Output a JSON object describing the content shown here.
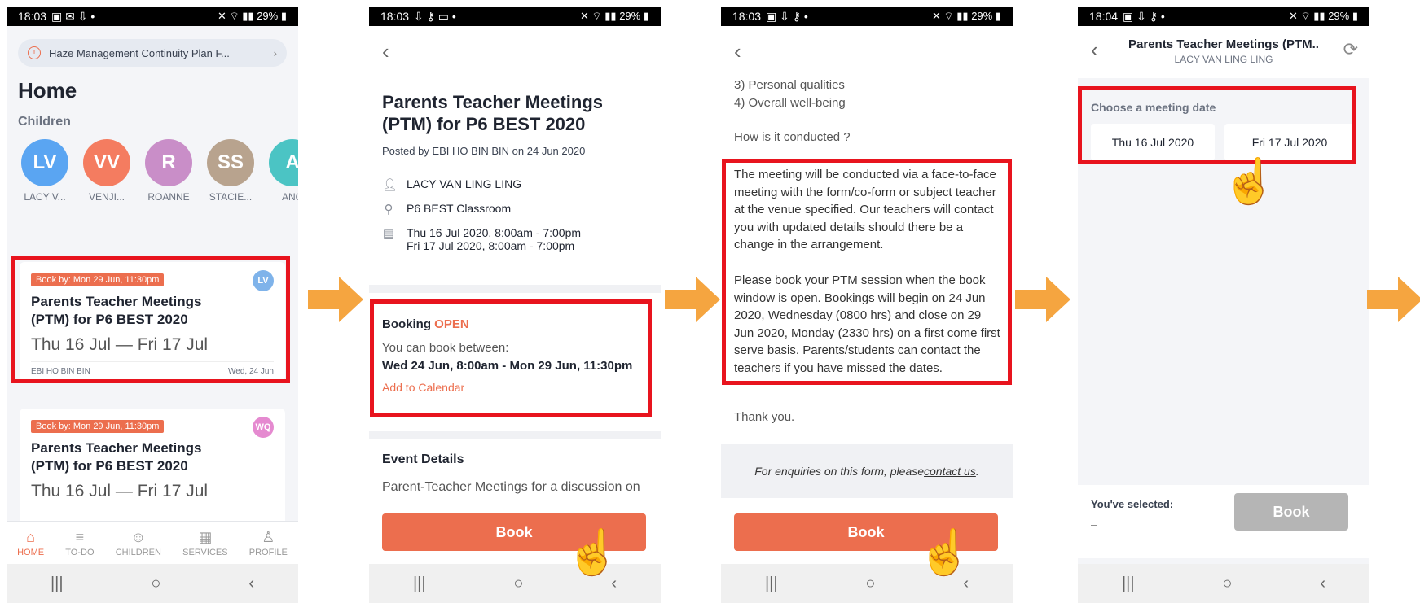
{
  "phone1": {
    "status": {
      "time": "18:03",
      "right": "29%"
    },
    "banner": "Haze Management Continuity Plan F...",
    "title": "Home",
    "children_label": "Children",
    "children": [
      {
        "initials": "LV",
        "name": "LACY V...",
        "color": "#5aa5f2"
      },
      {
        "initials": "VV",
        "name": "VENJI...",
        "color": "#f47c60"
      },
      {
        "initials": "R",
        "name": "ROANNE",
        "color": "#c98ec8"
      },
      {
        "initials": "SS",
        "name": "STACIE...",
        "color": "#b8a38e"
      },
      {
        "initials": "A",
        "name": "ANG",
        "color": "#4bc4c4"
      }
    ],
    "cards": [
      {
        "tag": "Book by: Mon 29 Jun, 11:30pm",
        "avatar": "LV",
        "avatar_color": "#7fb3ea",
        "title": "Parents Teacher Meetings (PTM) for P6 BEST 2020",
        "dates": "Thu 16 Jul — Fri 17 Jul",
        "author": "EBI HO BIN BIN",
        "posted": "Wed, 24 Jun"
      },
      {
        "tag": "Book by: Mon 29 Jun, 11:30pm",
        "avatar": "WQ",
        "avatar_color": "#e58ad0",
        "title": "Parents Teacher Meetings (PTM) for P6 BEST 2020",
        "dates": "Thu 16 Jul — Fri 17 Jul"
      }
    ],
    "tabs": [
      {
        "icon": "⌂",
        "label": "HOME"
      },
      {
        "icon": "≡",
        "label": "TO-DO"
      },
      {
        "icon": "☺",
        "label": "CHILDREN"
      },
      {
        "icon": "▦",
        "label": "SERVICES"
      },
      {
        "icon": "♙",
        "label": "PROFILE"
      }
    ]
  },
  "phone2": {
    "status": {
      "time": "18:03",
      "right": "29%"
    },
    "title": "Parents Teacher Meetings (PTM) for P6 BEST 2020",
    "posted_by": "Posted by EBI HO BIN BIN on 24 Jun 2020",
    "student": "LACY VAN LING LING",
    "venue": "P6 BEST Classroom",
    "date1": "Thu 16 Jul 2020, 8:00am - 7:00pm",
    "date2": "Fri 17 Jul 2020, 8:00am - 7:00pm",
    "booking_label": "Booking",
    "booking_status": "OPEN",
    "book_between": "You can book between:",
    "window": "Wed 24 Jun, 8:00am - Mon 29 Jun, 11:30pm",
    "add_calendar": "Add to Calendar",
    "event_details": "Event Details",
    "event_text": "Parent-Teacher Meetings for a discussion on",
    "book": "Book"
  },
  "phone3": {
    "status": {
      "time": "18:03",
      "right": "29%"
    },
    "line1": "3) Personal qualities",
    "line2": "4) Overall well-being",
    "how": "How is it  conducted ?",
    "para1": "The meeting will be conducted via a face-to-face meeting with the form/co-form or subject teacher at the venue specified. Our teachers will contact you with updated details should there be a change in the arrangement.",
    "para2": "Please book your PTM session when the book window is open. Bookings will begin on 24 Jun 2020, Wednesday (0800 hrs) and close on 29 Jun 2020, Monday (2330 hrs) on a first come first serve basis. Parents/students can contact the  teachers if you have missed the dates.",
    "thanks": "Thank you.",
    "enquiry_pre": "For enquiries on this form, please ",
    "enquiry_link": "contact us",
    "enquiry_post": ".",
    "book": "Book"
  },
  "phone4": {
    "status": {
      "time": "18:04",
      "right": "29%"
    },
    "title": "Parents Teacher Meetings (PTM..",
    "subtitle": "LACY VAN LING LING",
    "choose": "Choose a meeting date",
    "date_a": "Thu 16 Jul 2020",
    "date_b": "Fri 17 Jul 2020",
    "selected_label": "You've selected:",
    "selected_value": "–",
    "book": "Book"
  },
  "colors": {
    "accent": "#ec6e4e",
    "highlight": "#e8141e",
    "arrow": "#f5a540"
  }
}
